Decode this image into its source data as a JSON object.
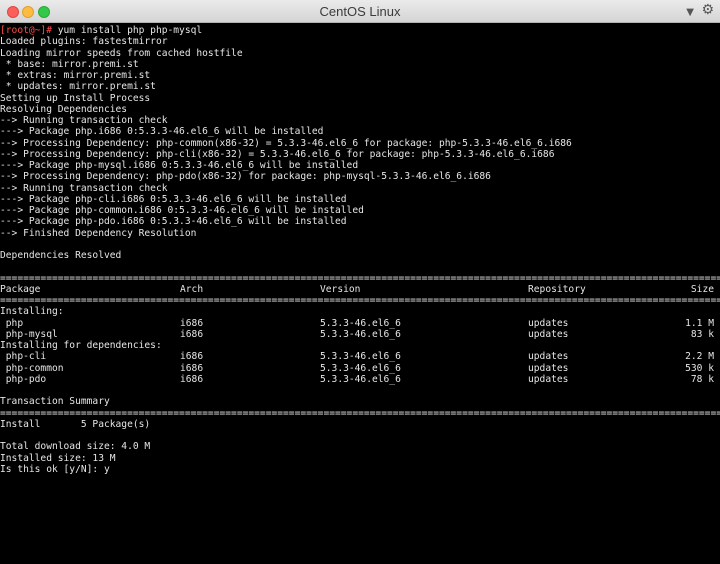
{
  "window": {
    "title": "CentOS Linux"
  },
  "colors": {
    "prompt": "#ff4b4b",
    "text": "#e6e6e6",
    "background": "#000000"
  },
  "icons": {
    "dropdown": "chevron-down-icon",
    "settings": "gear-icon"
  },
  "terminal": {
    "prompt": "[root@~]#",
    "command": " yum install php php-mysql",
    "lines_before_table": [
      "Loaded plugins: fastestmirror",
      "Loading mirror speeds from cached hostfile",
      " * base: mirror.premi.st",
      " * extras: mirror.premi.st",
      " * updates: mirror.premi.st",
      "Setting up Install Process",
      "Resolving Dependencies",
      "--> Running transaction check",
      "---> Package php.i686 0:5.3.3-46.el6_6 will be installed",
      "--> Processing Dependency: php-common(x86-32) = 5.3.3-46.el6_6 for package: php-5.3.3-46.el6_6.i686",
      "--> Processing Dependency: php-cli(x86-32) = 5.3.3-46.el6_6 for package: php-5.3.3-46.el6_6.i686",
      "---> Package php-mysql.i686 0:5.3.3-46.el6_6 will be installed",
      "--> Processing Dependency: php-pdo(x86-32) for package: php-mysql-5.3.3-46.el6_6.i686",
      "--> Running transaction check",
      "---> Package php-cli.i686 0:5.3.3-46.el6_6 will be installed",
      "---> Package php-common.i686 0:5.3.3-46.el6_6 will be installed",
      "---> Package php-pdo.i686 0:5.3.3-46.el6_6 will be installed",
      "--> Finished Dependency Resolution",
      "",
      "Dependencies Resolved",
      ""
    ],
    "table": {
      "headers": {
        "package": "Package",
        "arch": "Arch",
        "version": "Version",
        "repository": "Repository",
        "size": "Size"
      },
      "installing_label": "Installing:",
      "installing": [
        {
          "package": " php",
          "arch": "i686",
          "version": "5.3.3-46.el6_6",
          "repository": "updates",
          "size": "1.1 M"
        },
        {
          "package": " php-mysql",
          "arch": "i686",
          "version": "5.3.3-46.el6_6",
          "repository": "updates",
          "size": "83 k"
        }
      ],
      "deps_label": "Installing for dependencies:",
      "deps": [
        {
          "package": " php-cli",
          "arch": "i686",
          "version": "5.3.3-46.el6_6",
          "repository": "updates",
          "size": "2.2 M"
        },
        {
          "package": " php-common",
          "arch": "i686",
          "version": "5.3.3-46.el6_6",
          "repository": "updates",
          "size": "530 k"
        },
        {
          "package": " php-pdo",
          "arch": "i686",
          "version": "5.3.3-46.el6_6",
          "repository": "updates",
          "size": "78 k"
        }
      ]
    },
    "summary_title": "Transaction Summary",
    "install_line": "Install       5 Package(s)",
    "total_download": "Total download size: 4.0 M",
    "installed_size": "Installed size: 13 M",
    "confirm_prompt": "Is this ok [y/N]: y"
  }
}
